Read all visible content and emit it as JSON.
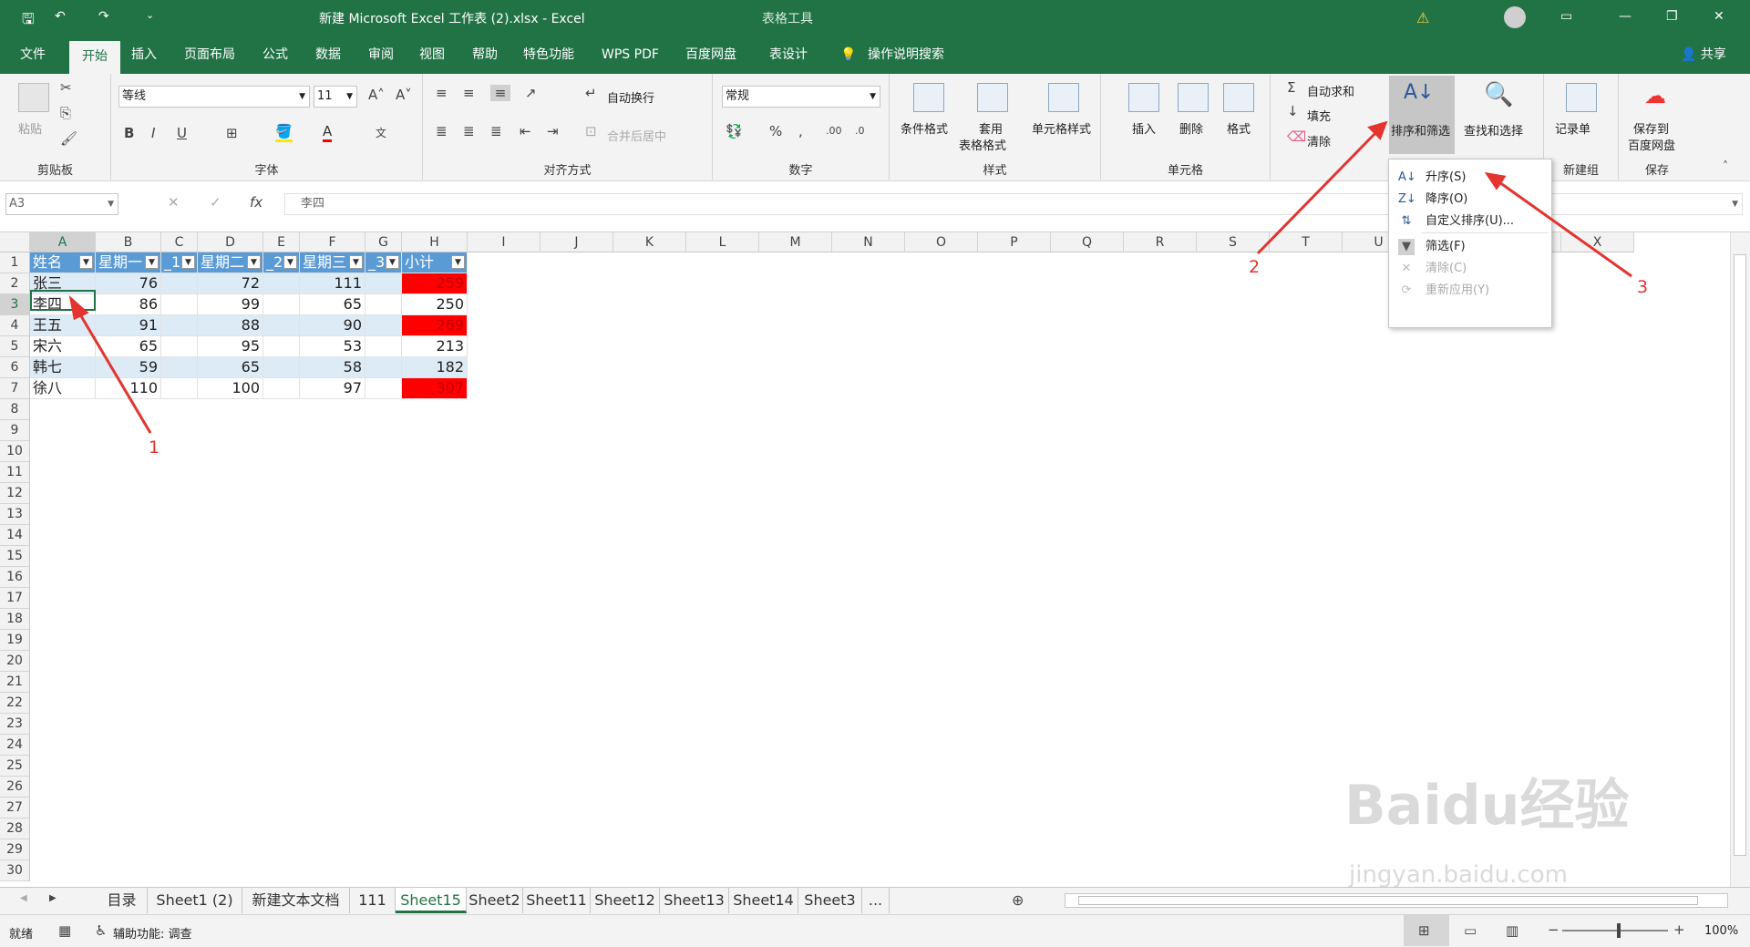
{
  "title_bar": {
    "doc_title": "新建 Microsoft Excel 工作表 (2).xlsx  -  Excel",
    "context_label": "表格工具",
    "warning_icon": "warning-icon",
    "user_avatar": "avatar"
  },
  "tabs": [
    "文件",
    "开始",
    "插入",
    "页面布局",
    "公式",
    "数据",
    "审阅",
    "视图",
    "帮助",
    "特色功能",
    "WPS PDF",
    "百度网盘",
    "表设计"
  ],
  "tell_me": "操作说明搜索",
  "share": "共享",
  "ribbon": {
    "clipboard": {
      "paste": "粘贴",
      "label": "剪贴板"
    },
    "font": {
      "name": "等线",
      "size": "11",
      "label": "字体"
    },
    "align": {
      "wrap": "自动换行",
      "merge": "合并后居中",
      "label": "对齐方式"
    },
    "number": {
      "format": "常规",
      "label": "数字"
    },
    "styles": {
      "cond": "条件格式",
      "table1": "套用",
      "table2": "表格格式",
      "cell": "单元格样式",
      "label": "样式"
    },
    "cells": {
      "insert": "插入",
      "delete": "删除",
      "format": "格式",
      "label": "单元格"
    },
    "edit": {
      "autosum": "自动求和",
      "fill": "填充",
      "clear": "清除",
      "sort": "排序和筛选",
      "find": "查找和选择"
    },
    "newgroup": {
      "record": "记录单",
      "label": "新建组"
    },
    "save": {
      "l1": "保存到",
      "l2": "百度网盘",
      "label": "保存"
    }
  },
  "formula_bar": {
    "name_box": "A3",
    "fx": "fx",
    "content": "李四"
  },
  "columns": [
    "A",
    "B",
    "C",
    "D",
    "E",
    "F",
    "G",
    "H",
    "I",
    "J",
    "K",
    "L",
    "M",
    "N",
    "O",
    "P",
    "Q",
    "R",
    "S",
    "T",
    "U",
    "V",
    "W",
    "X"
  ],
  "rows": [
    "1",
    "2",
    "3",
    "4",
    "5",
    "6",
    "7",
    "8",
    "9",
    "10",
    "11",
    "12",
    "13",
    "14",
    "15",
    "16",
    "17",
    "18",
    "19",
    "20",
    "21",
    "22",
    "23",
    "24",
    "25",
    "26",
    "27",
    "28",
    "29",
    "30"
  ],
  "table": {
    "headers": [
      "姓名",
      "星期一",
      "_1",
      "星期二",
      "_2",
      "星期三",
      "_3",
      "小计"
    ],
    "data": [
      [
        "张三",
        "76",
        "",
        "72",
        "",
        "111",
        "",
        "259"
      ],
      [
        "李四",
        "86",
        "",
        "99",
        "",
        "65",
        "",
        "250"
      ],
      [
        "王五",
        "91",
        "",
        "88",
        "",
        "90",
        "",
        "269"
      ],
      [
        "宋六",
        "65",
        "",
        "95",
        "",
        "53",
        "",
        "213"
      ],
      [
        "韩七",
        "59",
        "",
        "65",
        "",
        "58",
        "",
        "182"
      ],
      [
        "徐八",
        "110",
        "",
        "100",
        "",
        "97",
        "",
        "307"
      ]
    ],
    "highlight_color": "#ff0000",
    "header_color": "#5b9bd5",
    "band_color": "#ddebf7"
  },
  "dropdown": {
    "items": [
      {
        "label": "升序(S)",
        "icon": "sort-ascending-icon",
        "enabled": true
      },
      {
        "label": "降序(O)",
        "icon": "sort-descending-icon",
        "enabled": true
      },
      {
        "label": "自定义排序(U)...",
        "icon": "custom-sort-icon",
        "enabled": true
      },
      {
        "label": "筛选(F)",
        "icon": "filter-icon",
        "enabled": true
      },
      {
        "label": "清除(C)",
        "icon": "clear-filter-icon",
        "enabled": false
      },
      {
        "label": "重新应用(Y)",
        "icon": "reapply-icon",
        "enabled": false
      }
    ]
  },
  "sheets": [
    "目录",
    "Sheet1 (2)",
    "新建文本文档",
    "111",
    "Sheet15",
    "Sheet2",
    "Sheet11",
    "Sheet12",
    "Sheet13",
    "Sheet14",
    "Sheet3",
    "..."
  ],
  "active_sheet": "Sheet15",
  "status": {
    "ready": "就绪",
    "accessibility": "辅助功能: 调查",
    "zoom": "100%"
  },
  "annotations": [
    "1",
    "2",
    "3"
  ],
  "watermark": "Baidu经验",
  "watermark_url": "jingyan.baidu.com"
}
